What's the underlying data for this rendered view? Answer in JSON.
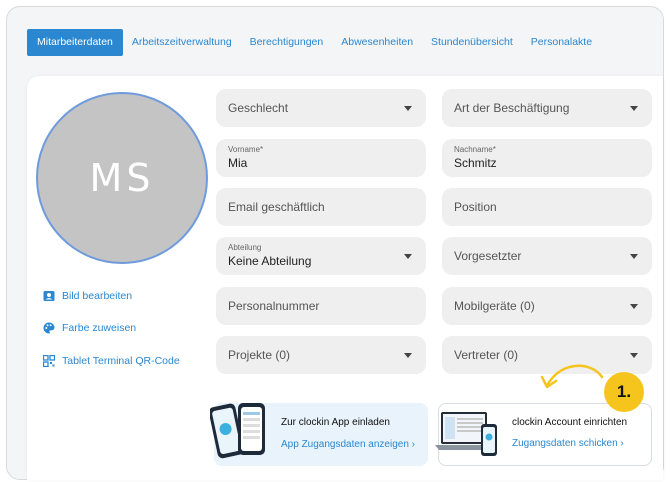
{
  "tabs": [
    {
      "label": "Mitarbeiterdaten",
      "active": true
    },
    {
      "label": "Arbeitszeitverwaltung"
    },
    {
      "label": "Berechtigungen"
    },
    {
      "label": "Abwesenheiten"
    },
    {
      "label": "Stundenübersicht"
    },
    {
      "label": "Personalakte"
    }
  ],
  "avatar": {
    "initials": "MS",
    "color": "#c4c4c4",
    "ring_color": "#6f9bdc"
  },
  "side_links": [
    {
      "label": "Bild bearbeiten",
      "icon": "image-icon"
    },
    {
      "label": "Farbe zuweisen",
      "icon": "palette-icon"
    },
    {
      "label": "Tablet Terminal QR-Code",
      "icon": "qr-code-icon"
    }
  ],
  "fields": {
    "geschlecht": {
      "placeholder": "Geschlecht"
    },
    "beschaeftigung": {
      "placeholder": "Art der Beschäftigung"
    },
    "vorname": {
      "label": "Vorname*",
      "value": "Mia"
    },
    "nachname": {
      "label": "Nachname*",
      "value": "Schmitz"
    },
    "email": {
      "placeholder": "Email geschäftlich"
    },
    "position": {
      "placeholder": "Position"
    },
    "abteilung": {
      "label": "Abteilung",
      "value": "Keine Abteilung"
    },
    "vorgesetzter": {
      "placeholder": "Vorgesetzter"
    },
    "personalnummer": {
      "placeholder": "Personalnummer"
    },
    "mobilgeraete": {
      "placeholder": "Mobilgeräte (0)"
    },
    "projekte": {
      "placeholder": "Projekte (0)"
    },
    "vertreter": {
      "placeholder": "Vertreter (0)"
    }
  },
  "cards": {
    "app": {
      "title": "Zur clockin App einladen",
      "link": "App Zugangsdaten anzeigen ›"
    },
    "account": {
      "title": "clockin Account einrichten",
      "link": "Zugangsdaten schicken ›"
    }
  },
  "badge": {
    "label": "1."
  },
  "colors": {
    "accent": "#2a87d0",
    "badge": "#f5c51d",
    "field_bg": "#efefef"
  }
}
